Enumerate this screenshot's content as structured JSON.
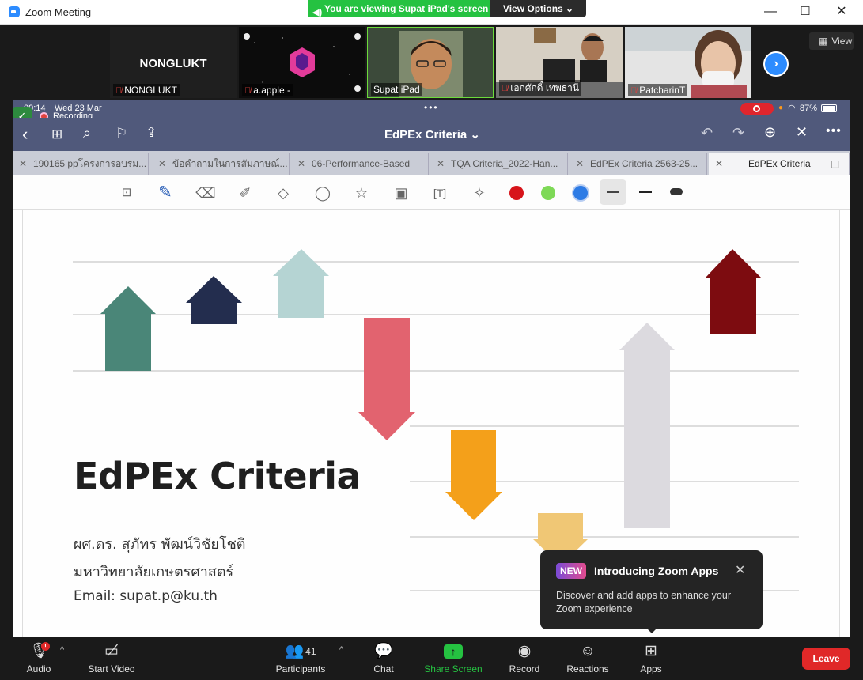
{
  "window": {
    "title": "Zoom Meeting",
    "minimize": "—",
    "maximize": "☐",
    "close": "✕"
  },
  "share_banner": {
    "text": "You are viewing Supat iPad's screen",
    "view_options": "View Options ⌄"
  },
  "gallery": {
    "view_label": "View",
    "participants": [
      {
        "name": "NONGLUKT",
        "big_name": "NONGLUKT",
        "muted": true
      },
      {
        "name": "a.apple -",
        "muted": true
      },
      {
        "name": "Supat iPad",
        "muted": false
      },
      {
        "name": "เอกศักดิ์ เทพธานี",
        "muted": true
      },
      {
        "name": "PatcharinT",
        "muted": true
      }
    ]
  },
  "ipad": {
    "time": "09:14",
    "date": "Wed 23 Mar",
    "recording": "Recording",
    "battery": "87%",
    "doc_title": "EdPEx Criteria ⌄",
    "tabs": [
      "190165 ppโครงการอบรม...",
      "ข้อคำถามในการสัมภาษณ์...",
      "06-Performance-Based",
      "TQA Criteria_2022-Han...",
      "EdPEx Criteria 2563-25...",
      "EdPEx Criteria"
    ],
    "colors": {
      "red": "#d7141a",
      "green": "#7ed957",
      "blue": "#2d7be5"
    }
  },
  "slide": {
    "title": "EdPEx Criteria",
    "author": "ผศ.ดร. สุภัทร พัฒน์วิชัยโชติ",
    "university": "มหาวิทยาลัยเกษตรศาสตร์",
    "email": "Email: supat.p@ku.th"
  },
  "popup": {
    "badge": "NEW",
    "heading": "Introducing Zoom Apps",
    "body": "Discover and add apps to enhance your Zoom experience"
  },
  "toolbar": {
    "audio": "Audio",
    "start_video": "Start Video",
    "participants": "Participants",
    "participants_count": "41",
    "chat": "Chat",
    "share_screen": "Share Screen",
    "record": "Record",
    "reactions": "Reactions",
    "apps": "Apps",
    "leave": "Leave"
  }
}
